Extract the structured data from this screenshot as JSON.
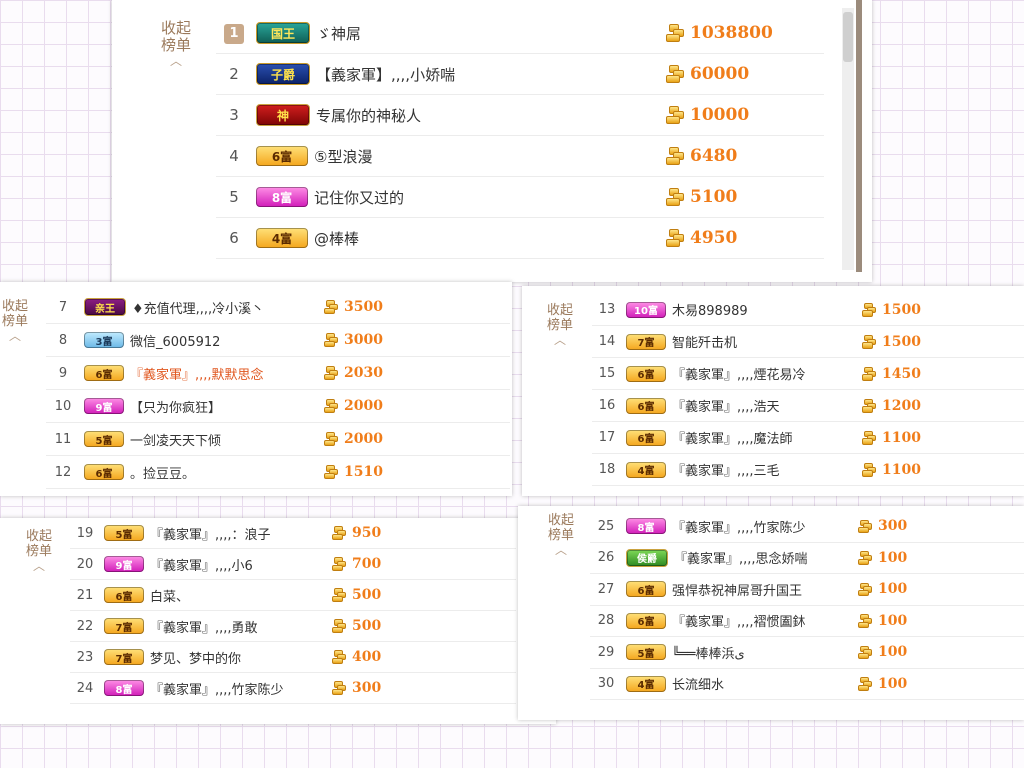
{
  "collapse_label_line1": "收起",
  "collapse_label_line2": "榜单",
  "collapse_arrow": "︿",
  "colors": {
    "score": "#f07d1a",
    "collapse": "#9b7a5c",
    "red_name": "#e0561e"
  },
  "icons": {
    "coin": "gold-coin-icon",
    "collapse_arrow": "chevron-up-icon"
  },
  "panels": [
    {
      "id": "ranks-1-6",
      "rows": [
        {
          "rank": "1",
          "badge": "国王",
          "badge_style": "b-king",
          "name": "ゞ神屌",
          "score": "1038800",
          "top": true
        },
        {
          "rank": "2",
          "badge": "子爵",
          "badge_style": "b-ziyue",
          "name": "【義家軍】,,,,小娇喘",
          "score": "60000"
        },
        {
          "rank": "3",
          "badge": "神",
          "badge_style": "b-shen",
          "name": "专属你的神秘人",
          "score": "10000"
        },
        {
          "rank": "4",
          "badge": "6富",
          "badge_style": "b-gold",
          "name": "⑤型浪漫",
          "score": "6480"
        },
        {
          "rank": "5",
          "badge": "8富",
          "badge_style": "b-pink",
          "name": "记住你又过的",
          "score": "5100"
        },
        {
          "rank": "6",
          "badge": "4富",
          "badge_style": "b-gold",
          "name": "@棒棒",
          "score": "4950"
        }
      ]
    },
    {
      "id": "ranks-7-12",
      "rows": [
        {
          "rank": "7",
          "badge": "亲王",
          "badge_style": "b-qinwang",
          "name": "♦充值代理,,,,冷小溪丶",
          "score": "3500"
        },
        {
          "rank": "8",
          "badge": "3富",
          "badge_style": "b-blue",
          "name": "微信_6005912",
          "score": "3000"
        },
        {
          "rank": "9",
          "badge": "6富",
          "badge_style": "b-gold",
          "name": "『義家軍』,,,,默默思念",
          "score": "2030",
          "red": true
        },
        {
          "rank": "10",
          "badge": "9富",
          "badge_style": "b-pink",
          "name": "【只为你疯狂】",
          "score": "2000"
        },
        {
          "rank": "11",
          "badge": "5富",
          "badge_style": "b-gold",
          "name": "一剑凌天天下倾",
          "score": "2000"
        },
        {
          "rank": "12",
          "badge": "6富",
          "badge_style": "b-gold",
          "name": "。捡豆豆。",
          "score": "1510"
        }
      ]
    },
    {
      "id": "ranks-13-18",
      "rows": [
        {
          "rank": "13",
          "badge": "10富",
          "badge_style": "b-pink",
          "name": "木易898989",
          "score": "1500"
        },
        {
          "rank": "14",
          "badge": "7富",
          "badge_style": "b-gold",
          "name": "智能歼击机",
          "score": "1500"
        },
        {
          "rank": "15",
          "badge": "6富",
          "badge_style": "b-gold",
          "name": "『義家軍』,,,,煙花易冷",
          "score": "1450"
        },
        {
          "rank": "16",
          "badge": "6富",
          "badge_style": "b-gold",
          "name": "『義家軍』,,,,浩天",
          "score": "1200"
        },
        {
          "rank": "17",
          "badge": "6富",
          "badge_style": "b-gold",
          "name": "『義家軍』,,,,魔法師",
          "score": "1100"
        },
        {
          "rank": "18",
          "badge": "4富",
          "badge_style": "b-gold",
          "name": "『義家軍』,,,,三毛",
          "score": "1100"
        }
      ]
    },
    {
      "id": "ranks-19-24",
      "rows": [
        {
          "rank": "19",
          "badge": "5富",
          "badge_style": "b-gold",
          "name": "『義家軍』,,,,：浪子",
          "score": "950"
        },
        {
          "rank": "20",
          "badge": "9富",
          "badge_style": "b-pink",
          "name": "『義家軍』,,,,小6",
          "score": "700"
        },
        {
          "rank": "21",
          "badge": "6富",
          "badge_style": "b-gold",
          "name": "白菜、",
          "score": "500"
        },
        {
          "rank": "22",
          "badge": "7富",
          "badge_style": "b-gold",
          "name": "『義家軍』,,,,勇敢",
          "score": "500"
        },
        {
          "rank": "23",
          "badge": "7富",
          "badge_style": "b-gold",
          "name": "梦见、梦中的你",
          "score": "400"
        },
        {
          "rank": "24",
          "badge": "8富",
          "badge_style": "b-pink",
          "name": "『義家軍』,,,,竹家陈少",
          "score": "300"
        }
      ]
    },
    {
      "id": "ranks-25-30",
      "rows": [
        {
          "rank": "25",
          "badge": "8富",
          "badge_style": "b-pink",
          "name": "『義家軍』,,,,竹家陈少",
          "score": "300"
        },
        {
          "rank": "26",
          "badge": "侯爵",
          "badge_style": "b-green",
          "name": "『義家軍』,,,,思念娇喘",
          "score": "100"
        },
        {
          "rank": "27",
          "badge": "6富",
          "badge_style": "b-gold",
          "name": "强悍恭祝神屌哥升国王",
          "score": "100"
        },
        {
          "rank": "28",
          "badge": "6富",
          "badge_style": "b-gold",
          "name": "『義家軍』,,,,褶惯圔鈢",
          "score": "100"
        },
        {
          "rank": "29",
          "badge": "5富",
          "badge_style": "b-gold",
          "name": "╚══棒棒浜ی",
          "score": "100"
        },
        {
          "rank": "30",
          "badge": "4富",
          "badge_style": "b-gold",
          "name": "长流细水",
          "score": "100"
        }
      ]
    }
  ]
}
